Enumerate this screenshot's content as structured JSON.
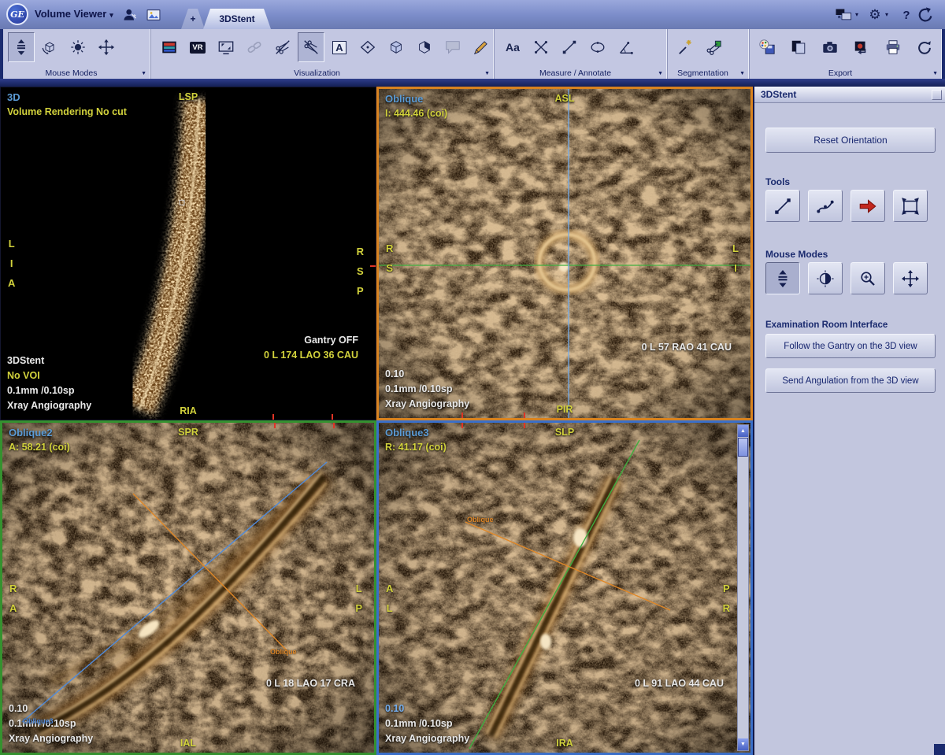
{
  "titlebar": {
    "logo": "GE",
    "app_name": "Volume Viewer",
    "add_tab_label": "+",
    "tab_label": "3DStent"
  },
  "icons": {
    "menu_triangle": "▾",
    "group_triangle": "▼",
    "gear": "⚙",
    "help": "?",
    "scroll_up": "▲",
    "scroll_down": "▼"
  },
  "toolbar": {
    "mouse_modes_label": "Mouse Modes",
    "visualization_label": "Visualization",
    "measure_label": "Measure / Annotate",
    "segmentation_label": "Segmentation",
    "export_label": "Export",
    "vr_icon_label": "VR",
    "annotate_a_label": "A",
    "text_tool_label": "Aa"
  },
  "viewports": {
    "v1": {
      "name": "3D",
      "render_mode": "Volume Rendering No cut",
      "orient_top": "LSP",
      "orient_bottom": "RIA",
      "orient_left": [
        "L",
        "I",
        "A"
      ],
      "orient_right": [
        "R",
        "S",
        "P"
      ],
      "gantry": "Gantry OFF",
      "angulation": "0 L 174 LAO 36 CAU",
      "series": "3DStent",
      "voi": "No VOI",
      "spacing": "0.1mm /0.10sp",
      "modality": "Xray Angiography"
    },
    "v2": {
      "name": "Oblique",
      "value": "I: 444.46 (coi)",
      "orient_top": "ASL",
      "orient_bottom": "PIR",
      "orient_left": [
        "R",
        "S"
      ],
      "orient_right": [
        "L",
        "I"
      ],
      "angulation": "0 L 57 RAO 41 CAU",
      "thickness": "0.10",
      "spacing": "0.1mm /0.10sp",
      "modality": "Xray Angiography"
    },
    "v3": {
      "name": "Oblique2",
      "value": "A: 58.21 (coi)",
      "orient_top": "SPR",
      "orient_bottom": "IAL",
      "orient_left": [
        "R",
        "A"
      ],
      "orient_right": [
        "L",
        "P"
      ],
      "angulation": "0 L 18 LAO 17 CRA",
      "thickness": "0.10",
      "spacing": "0.1mm /0.10sp",
      "modality": "Xray Angiography",
      "oblique_line_label": "Oblique",
      "oblique3_line_label": "Oblique3"
    },
    "v4": {
      "name": "Oblique3",
      "value": "R: 41.17 (coi)",
      "orient_top": "SLP",
      "orient_bottom": "IRA",
      "orient_left": [
        "A",
        "L"
      ],
      "orient_right": [
        "P",
        "R"
      ],
      "angulation": "0 L 91 LAO 44 CAU",
      "thickness": "0.10",
      "spacing": "0.1mm /0.10sp",
      "modality": "Xray Angiography",
      "oblique_line_label": "Oblique"
    }
  },
  "panel": {
    "title": "3DStent",
    "reset_button_label": "Reset Orientation",
    "tools_label": "Tools",
    "mouse_modes_label": "Mouse Modes",
    "eri_label": "Examination Room Interface",
    "follow_button_label": "Follow the Gantry on the 3D view",
    "send_button_label": "Send Angulation from the 3D view"
  },
  "colors": {
    "oblique_border": "#d9831f",
    "oblique2_border": "#35912f",
    "oblique3_border": "#3a6fc9",
    "viewport_name_blue": "#5b9bd5",
    "annotation_yellow": "#d2d23c",
    "crosshair_green": "#3fae3f",
    "crosshair_blue": "#74aceb",
    "oblique_line_orange": "#e08828"
  }
}
